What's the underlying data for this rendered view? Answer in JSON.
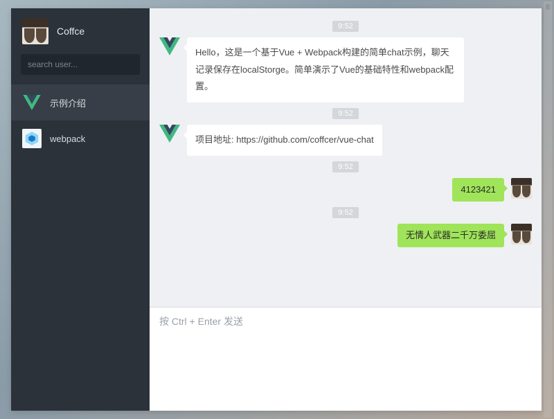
{
  "me": {
    "name": "Coffce"
  },
  "search": {
    "placeholder": "search user..."
  },
  "sidebar": {
    "items": [
      {
        "label": "示例介绍",
        "active": true,
        "icon": "vue"
      },
      {
        "label": "webpack",
        "active": false,
        "icon": "webpack"
      }
    ]
  },
  "messages": [
    {
      "time": "9:52",
      "side": "left",
      "avatar": "vue",
      "text": "Hello，这是一个基于Vue + Webpack构建的简单chat示例，聊天记录保存在localStorge。简单演示了Vue的基础特性和webpack配置。"
    },
    {
      "time": "9:52",
      "side": "left",
      "avatar": "vue",
      "text": "项目地址: https://github.com/coffcer/vue-chat"
    },
    {
      "time": "9:52",
      "side": "right",
      "avatar": "coffee",
      "text": "4123421"
    },
    {
      "time": "9:52",
      "side": "right",
      "avatar": "coffee",
      "text": "无情人武器二千万委屈"
    }
  ],
  "composer": {
    "placeholder": "按 Ctrl + Enter 发送"
  },
  "icons": {
    "vue": "vue-icon",
    "webpack": "webpack-icon"
  },
  "colors": {
    "accent": "#9fe459",
    "sidebar": "#2b323a"
  }
}
